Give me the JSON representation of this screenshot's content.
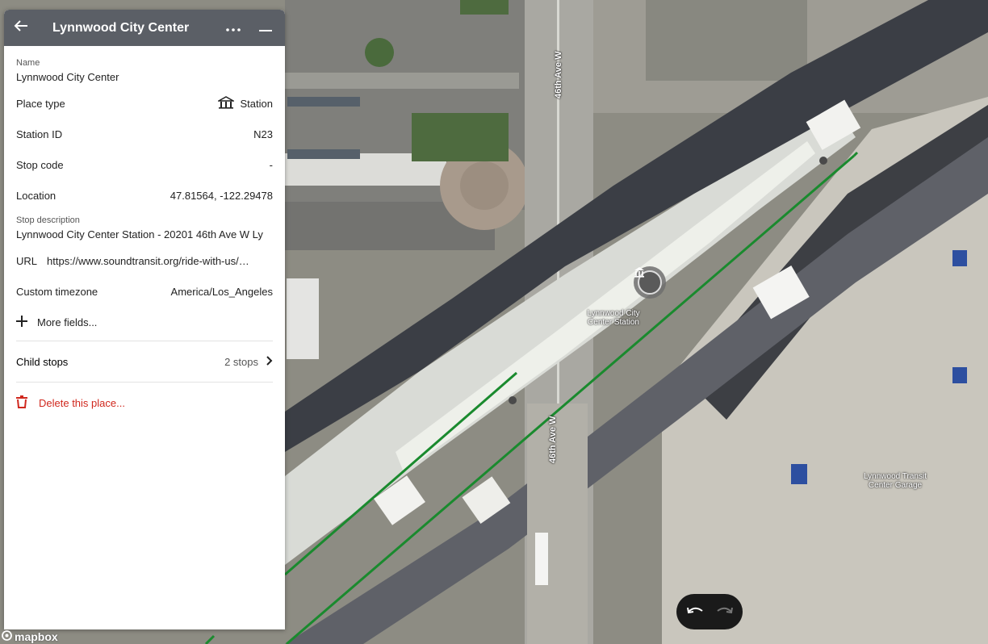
{
  "panel": {
    "title": "Lynnwood City Center",
    "name_label": "Name",
    "name_value": "Lynnwood City Center",
    "place_type_label": "Place type",
    "place_type_value": "Station",
    "station_id_label": "Station ID",
    "station_id_value": "N23",
    "stop_code_label": "Stop code",
    "stop_code_value": "-",
    "location_label": "Location",
    "location_value": "47.81564, -122.29478",
    "stop_description_label": "Stop description",
    "stop_description_value": "Lynnwood City Center Station - 20201 46th Ave W Ly",
    "url_label": "URL",
    "url_value": "https://www.soundtransit.org/ride-with-us/…",
    "timezone_label": "Custom timezone",
    "timezone_value": "America/Los_Angeles",
    "more_fields_label": "More fields...",
    "child_stops_label": "Child stops",
    "child_stops_value": "2 stops",
    "delete_label": "Delete this place..."
  },
  "map": {
    "road_label_top": "46th Ave W",
    "road_label_bottom": "46th Ave W",
    "station_label": "Lynnwood City Center Station",
    "garage_label": "Lynnwood Transit Center Garage",
    "attribution": "mapbox",
    "route_color": "#1a8a2e"
  },
  "icons": {
    "back": "arrow-left-icon",
    "menu": "more-icon",
    "minimize": "minimize-icon",
    "station": "station-icon",
    "add": "plus-icon",
    "chevron": "chevron-right-icon",
    "delete": "trash-icon",
    "undo": "undo-icon",
    "redo": "redo-icon"
  }
}
